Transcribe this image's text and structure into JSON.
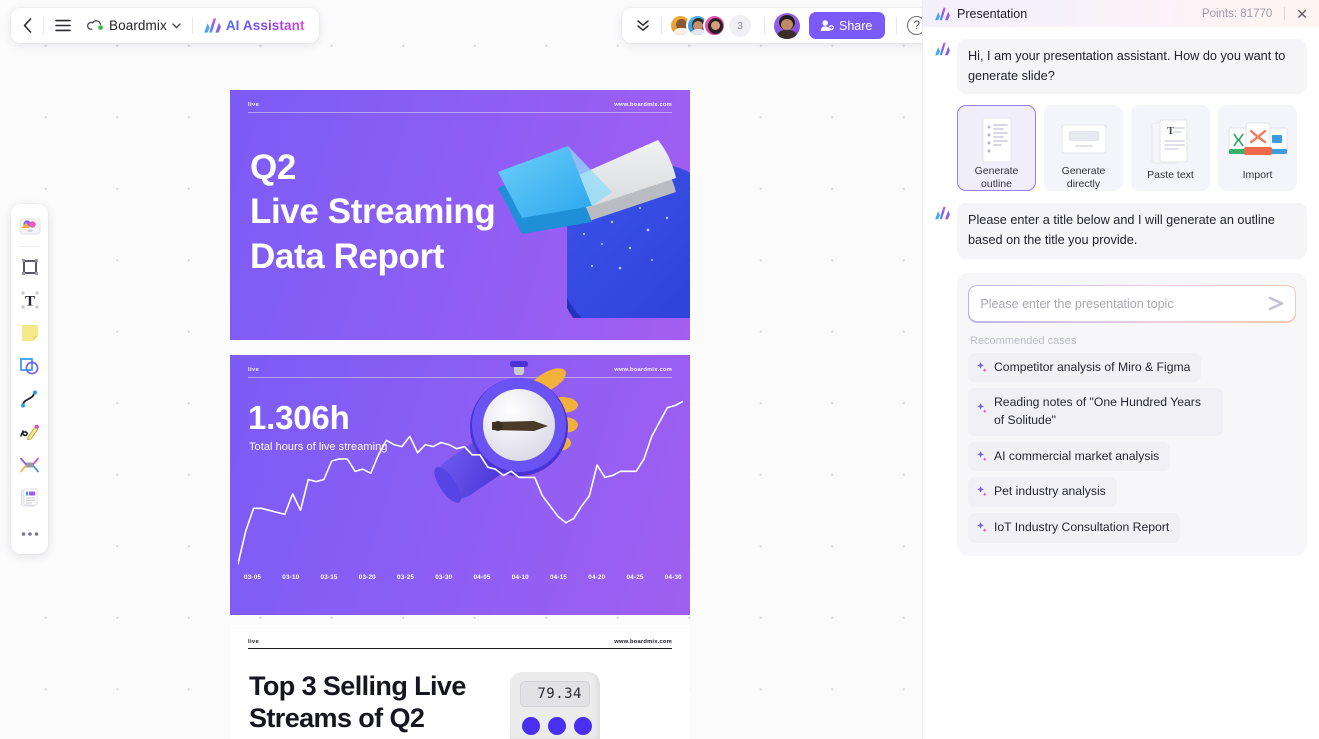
{
  "topbar": {
    "back_icon": "chevron-left-icon",
    "menu_icon": "hamburger-menu-icon",
    "brand_label": "Boardmix",
    "brand_caret": "⌄",
    "ai_label": "AI Assistant",
    "collapse_icon": "double-chevron-down-icon",
    "collaborator_count": "3",
    "share_label": "Share",
    "help_label": "?"
  },
  "toolbar": {
    "items": [
      {
        "name": "templates-icon",
        "label": "Templates"
      },
      {
        "name": "frame-icon",
        "label": "Frame"
      },
      {
        "name": "text-icon",
        "label": "Text"
      },
      {
        "name": "sticky-note-icon",
        "label": "Sticky note"
      },
      {
        "name": "shapes-icon",
        "label": "Shapes"
      },
      {
        "name": "connector-icon",
        "label": "Connector"
      },
      {
        "name": "pen-icon",
        "label": "Pen"
      },
      {
        "name": "mindmap-icon",
        "label": "Mind map"
      },
      {
        "name": "document-icon",
        "label": "Document"
      },
      {
        "name": "more-icon",
        "label": "More"
      }
    ]
  },
  "slides": [
    {
      "id": "slide1",
      "header_left": "live",
      "header_right": "www.boardmix.com",
      "title": "Q2\nLive Streaming\nData Report",
      "title_lines": [
        "Q2",
        "Live Streaming",
        "Data Report"
      ],
      "art": "3d-pie-chart-illustration"
    },
    {
      "id": "slide2",
      "header_left": "live",
      "header_right": "www.boardmix.com",
      "metric": "1.306h",
      "metric_caption": "Total hours of live streaming",
      "art": "3d-hand-holding-stopwatch-illustration"
    },
    {
      "id": "slide3",
      "header_left": "live",
      "header_right": "www.boardmix.com",
      "title_lines": [
        "Top 3 Selling Live",
        "Streams of Q2"
      ],
      "art": "3d-calculator-illustration",
      "display_value": "79.34"
    }
  ],
  "chart_data": {
    "type": "line",
    "title": "Total hours of live streaming",
    "xlabel": "",
    "ylabel": "",
    "grid": false,
    "legend": "none",
    "categories": [
      "03-05",
      "03-10",
      "03-15",
      "03-20",
      "03-25",
      "03-30",
      "04-05",
      "04-10",
      "04-15",
      "04-20",
      "04-25",
      "04-30"
    ],
    "tick_labels": [
      "03-05",
      "03-10",
      "03-15",
      "03-20",
      "03-25",
      "03-30",
      "04-05",
      "04-10",
      "04-15",
      "04-20",
      "04-25",
      "04-30"
    ],
    "x": [
      0,
      1,
      2,
      3,
      4,
      5,
      6,
      7,
      8,
      9,
      10,
      11,
      12,
      13,
      14,
      15,
      16,
      17,
      18,
      19,
      20,
      21,
      22,
      23,
      24,
      25,
      26,
      27,
      28,
      29,
      30,
      31,
      32,
      33,
      34,
      35,
      36,
      37,
      38,
      39,
      40,
      41,
      42,
      43,
      44,
      45,
      46,
      47,
      48,
      49,
      50,
      51,
      52,
      53,
      54,
      55,
      56,
      57
    ],
    "values": [
      4,
      20,
      31,
      31,
      30,
      29,
      28,
      38,
      30,
      45,
      44,
      45,
      54,
      55,
      55,
      49,
      50,
      48,
      57,
      64,
      62,
      61,
      66,
      58,
      62,
      61,
      63,
      62,
      60,
      61,
      57,
      57,
      51,
      50,
      47,
      49,
      46,
      46,
      46,
      37,
      32,
      27,
      24,
      26,
      32,
      37,
      52,
      46,
      47,
      49,
      49,
      49,
      55,
      66,
      73,
      80,
      81,
      83
    ],
    "ylim": [
      0,
      90
    ],
    "line_color": "#ffffff"
  },
  "panel": {
    "logo_icon": "ai-logo-icon",
    "title": "Presentation",
    "points_label": "Points: 81770",
    "close_icon": "close-icon",
    "messages": [
      {
        "from": "assistant",
        "text": "Hi, I am your presentation assistant. How do you want to generate slide?"
      },
      {
        "from": "assistant",
        "text": "Please enter a title below and I will generate an outline based on the title you provide."
      }
    ],
    "options": [
      {
        "label": "Generate outline",
        "icon": "outline-document-icon",
        "selected": true
      },
      {
        "label": "Generate directly",
        "icon": "slide-card-icon",
        "selected": false
      },
      {
        "label": "Paste text",
        "icon": "text-document-icon",
        "selected": false
      },
      {
        "label": "Import",
        "icon": "import-files-icon",
        "selected": false
      }
    ],
    "compose": {
      "placeholder": "Please enter the presentation topic",
      "value": "",
      "send_icon": "send-arrow-icon"
    },
    "recommended_label": "Recommended cases",
    "recommended": [
      "Competitor analysis of Miro & Figma",
      "Reading notes of \"One Hundred Years of Solitude\"",
      "AI commercial market analysis",
      "Pet industry analysis",
      "IoT Industry Consultation Report"
    ]
  },
  "colors": {
    "accent": "#7a5af8",
    "panel_bg": "#ffffff",
    "canvas_bg": "#fbfbfc",
    "slide_purple": "#8a5ef5",
    "selected_card_border": "#9a7df4"
  }
}
